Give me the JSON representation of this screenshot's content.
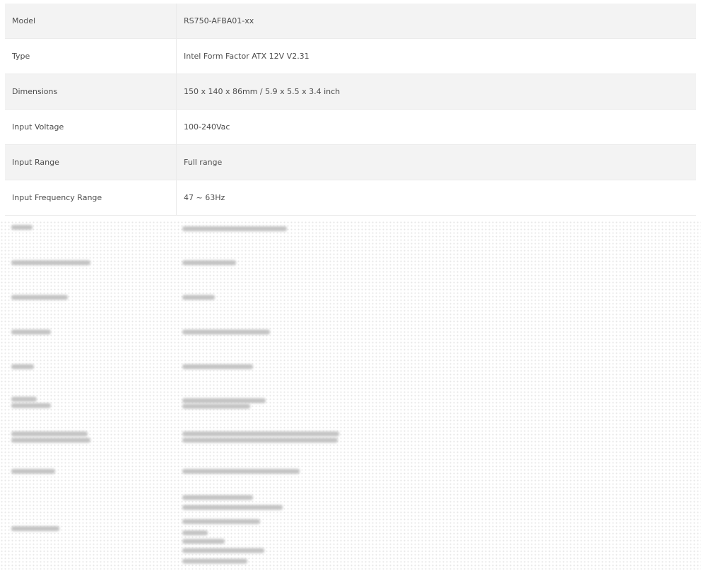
{
  "specs": [
    {
      "label": "Model",
      "value": "RS750-AFBA01-xx"
    },
    {
      "label": "Type",
      "value": "Intel Form Factor ATX 12V V2.31"
    },
    {
      "label": "Dimensions",
      "value": "150 x 140 x 86mm / 5.9 x 5.5 x 3.4 inch"
    },
    {
      "label": "Input Voltage",
      "value": "100-240Vac"
    },
    {
      "label": "Input Range",
      "value": "Full range"
    },
    {
      "label": "Input Frequency Range",
      "value": "47 ~ 63Hz"
    }
  ]
}
